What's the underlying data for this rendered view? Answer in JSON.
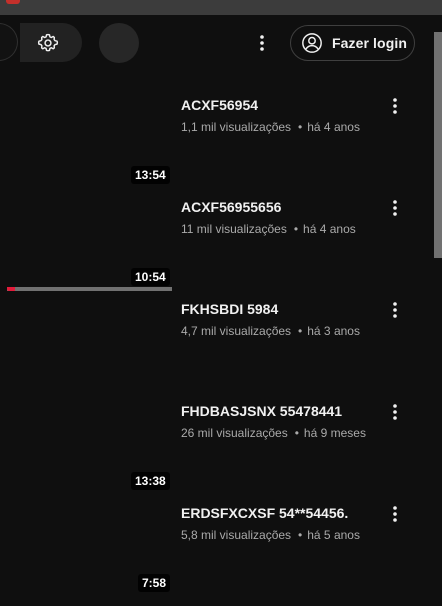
{
  "header": {
    "login_label": "Fazer login"
  },
  "videos": [
    {
      "title": "ACXF56954",
      "views": "1,1 mil visualizações",
      "age": "há 4 anos",
      "duration": "13:54",
      "progress": 0
    },
    {
      "title": "ACXF56955656",
      "views": "11 mil visualizações",
      "age": "há 4 anos",
      "duration": "10:54",
      "progress": 0.05
    },
    {
      "title": "FKHSBDI 5984",
      "views": "4,7 mil visualizações",
      "age": "há 3 anos",
      "duration": "",
      "progress": 0
    },
    {
      "title": "FHDBASJSNX 55478441",
      "views": "26 mil visualizações",
      "age": "há 9 meses",
      "duration": "13:38",
      "progress": 0
    },
    {
      "title": "ERDSFXCXSF 54**54456.",
      "views": "5,8 mil visualizações",
      "age": "há 5 anos",
      "duration": "7:58",
      "progress": 0
    }
  ],
  "colors": {
    "background": "#0f0f0f",
    "progress": "#e31b3a",
    "meta_text": "#aaaaaa"
  }
}
